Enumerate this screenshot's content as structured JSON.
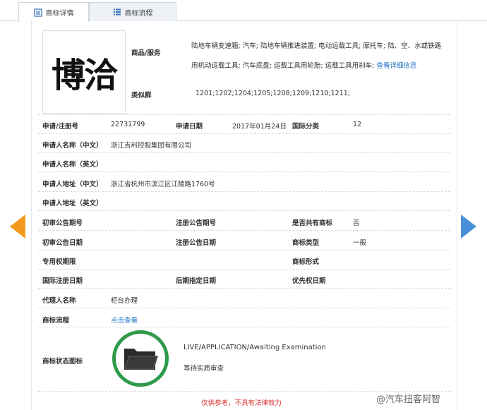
{
  "tabs": [
    {
      "label": "商标详情"
    },
    {
      "label": "商标流程"
    }
  ],
  "logo": {
    "text": "博洽"
  },
  "goods": {
    "label": "商品/服务",
    "text": "陆地车辆变速箱; 汽车; 陆地车辆推进装置; 电动运载工具; 摩托车; 陆、空、水或铁路用机动运载工具; 汽车底盘; 运载工具用轮胎; 运载工具用刹车;",
    "link": "查看详细信息"
  },
  "similar_group": {
    "label": "类似群",
    "value": "1201;1202;1204;1205;1208;1209;1210;1211;"
  },
  "details": {
    "reg_no_label": "申请/注册号",
    "reg_no": "22731799",
    "apply_date_label": "申请日期",
    "apply_date": "2017年01月24日",
    "intl_class_label": "国际分类",
    "intl_class": "12",
    "applicant_cn_label": "申请人名称（中文）",
    "applicant_cn": "浙江吉利控股集团有限公司",
    "applicant_en_label": "申请人名称（英文）",
    "address_cn_label": "申请人地址（中文）",
    "address_cn": "浙江省杭州市滨江区江陵路1760号",
    "address_en_label": "申请人地址（英文）",
    "prelim_pub_no_label": "初审公告期号",
    "reg_pub_no_label": "注册公告期号",
    "shared_label": "是否共有商标",
    "shared": "否",
    "prelim_pub_date_label": "初审公告日期",
    "reg_pub_date_label": "注册公告日期",
    "tm_type_label": "商标类型",
    "tm_type": "一般",
    "exclusive_period_label": "专用权期限",
    "tm_form_label": "商标形式",
    "intl_reg_date_label": "国际注册日期",
    "later_date_label": "后期指定日期",
    "priority_date_label": "优先权日期",
    "agent_label": "代理人名称",
    "agent": "柜台办理",
    "flow_label": "商标流程",
    "flow_link": "点击查看",
    "status_icon_label": "商标状态图标"
  },
  "status": {
    "en": "LIVE/APPLICATION/Awaiting Examination",
    "cn": "等待实质审查"
  },
  "disclaimer": "仅供参考，不具有法律效力",
  "watermark": "@汽车扭客阿智",
  "colors": {
    "accent": "#1d6fc7",
    "status_ring": "#2e9a4a",
    "prev_arrow": "#f39a1e",
    "next_arrow": "#4a90d9",
    "disclaimer": "#d9302c"
  }
}
